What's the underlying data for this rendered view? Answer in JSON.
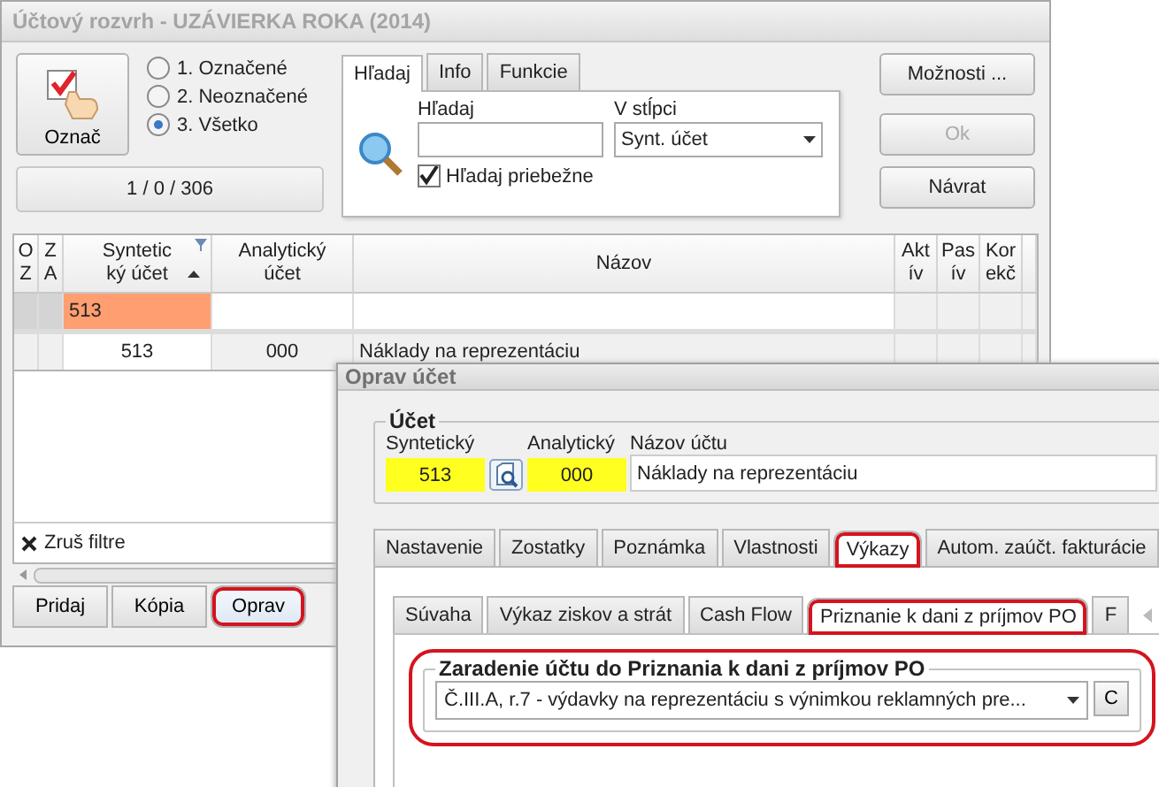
{
  "window": {
    "title": "Účtový rozvrh - UZÁVIERKA ROKA (2014)"
  },
  "mark_button": {
    "label": "Označ"
  },
  "filter_options": [
    {
      "label": "1. Označené",
      "selected": false
    },
    {
      "label": "2. Neoznačené",
      "selected": false
    },
    {
      "label": "3. Všetko",
      "selected": true
    }
  ],
  "counter": "1 / 0 / 306",
  "search_tabs": [
    {
      "label": "Hľadaj",
      "selected": true
    },
    {
      "label": "Info",
      "selected": false
    },
    {
      "label": "Funkcie",
      "selected": false
    }
  ],
  "search": {
    "label": "Hľadaj",
    "column_label": "V stĺpci",
    "column_value": "Synt. účet",
    "incremental": {
      "label": "Hľadaj priebežne",
      "checked": true
    }
  },
  "side_buttons": [
    {
      "label": "Možnosti ...",
      "disabled": false
    },
    {
      "label": "Ok",
      "disabled": true
    },
    {
      "label": "Návrat",
      "disabled": false
    }
  ],
  "table": {
    "columns": [
      {
        "lines": [
          "O",
          "Z"
        ],
        "kind": "flag"
      },
      {
        "lines": [
          "Z",
          "A"
        ],
        "kind": "flag"
      },
      {
        "lines": [
          "Syntetic",
          "ký účet"
        ],
        "kind": "synthetic",
        "sorted_ascending": true,
        "filtered": true
      },
      {
        "lines": [
          "Analytický",
          "účet"
        ],
        "kind": "analytic"
      },
      {
        "lines": [
          "Názov"
        ],
        "kind": "name"
      },
      {
        "lines": [
          "Akt",
          "ív"
        ],
        "kind": "flag"
      },
      {
        "lines": [
          "Pas",
          "ív"
        ],
        "kind": "flag"
      },
      {
        "lines": [
          "Kor",
          "ekč"
        ],
        "kind": "flag"
      },
      {
        "kind": "cut"
      }
    ],
    "filter": {
      "synthetic": "513"
    },
    "rows": [
      {
        "synthetic": "513",
        "analytic": "000",
        "name": "Náklady na reprezentáciu"
      }
    ]
  },
  "clear_filter": "Zruš filtre",
  "bottom_buttons": [
    {
      "label": "Pridaj",
      "highlighted": false
    },
    {
      "label": "Kópia",
      "highlighted": false
    },
    {
      "label": "Oprav",
      "highlighted": true
    }
  ],
  "dialog": {
    "title": "Oprav účet",
    "account_group": {
      "title": "Účet",
      "synthetic_label": "Syntetický",
      "synthetic": "513",
      "analytic_label": "Analytický",
      "analytic": "000",
      "name_label": "Názov účtu",
      "name": "Náklady na reprezentáciu"
    },
    "tabs": [
      {
        "label": "Nastavenie",
        "selected": false,
        "highlighted": false
      },
      {
        "label": "Zostatky",
        "selected": false,
        "highlighted": false
      },
      {
        "label": "Poznámka",
        "selected": false,
        "highlighted": false
      },
      {
        "label": "Vlastnosti",
        "selected": false,
        "highlighted": false
      },
      {
        "label": "Výkazy",
        "selected": true,
        "highlighted": true
      },
      {
        "label": "Autom. zaúčt. fakturácie",
        "selected": false,
        "highlighted": false
      }
    ],
    "subtabs": [
      {
        "label": "Súvaha",
        "selected": false,
        "highlighted": false
      },
      {
        "label": "Výkaz ziskov a strát",
        "selected": false,
        "highlighted": false
      },
      {
        "label": "Cash Flow",
        "selected": false,
        "highlighted": false
      },
      {
        "label": "Priznanie k dani z príjmov PO",
        "selected": true,
        "highlighted": true
      },
      {
        "label": "F",
        "selected": false,
        "highlighted": false
      }
    ],
    "tax_group": {
      "title": "Zaradenie účtu do Priznania k dani z príjmov PO",
      "value": "Č.III.A, r.7 - výdavky na reprezentáciu s výnimkou reklamných pre...",
      "clear_button": "C",
      "highlighted": true
    }
  }
}
